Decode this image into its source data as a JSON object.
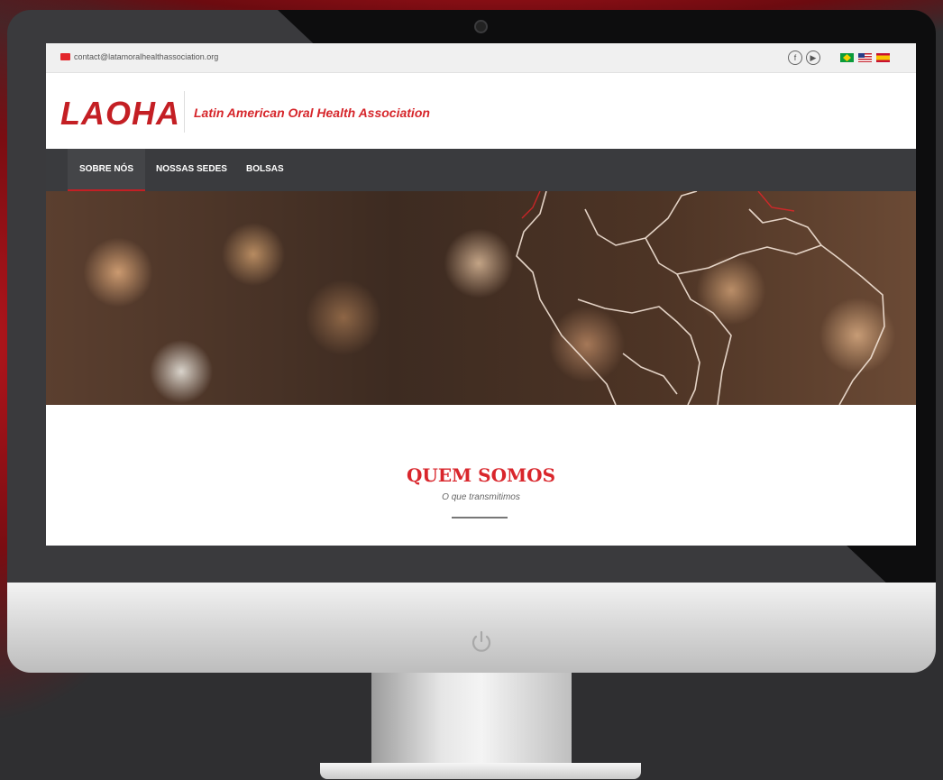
{
  "topbar": {
    "email": "contact@latamoralhealthassociation.org",
    "icons": [
      "mail-icon",
      "facebook-icon",
      "youtube-icon"
    ],
    "languages": [
      "brazil-flag",
      "usa-flag",
      "spain-flag"
    ]
  },
  "header": {
    "logo": "LAOHA",
    "tagline": "Latin American Oral Health Association"
  },
  "nav": {
    "items": [
      {
        "label": "SOBRE NÓS",
        "active": true
      },
      {
        "label": "NOSSAS SEDES",
        "active": false
      },
      {
        "label": "BOLSAS",
        "active": false
      }
    ]
  },
  "section": {
    "title": "QUEM SOMOS",
    "subtitle": "O que transmitimos"
  },
  "colors": {
    "brand": "#c41f24",
    "nav_bg": "#3a3b3e"
  }
}
